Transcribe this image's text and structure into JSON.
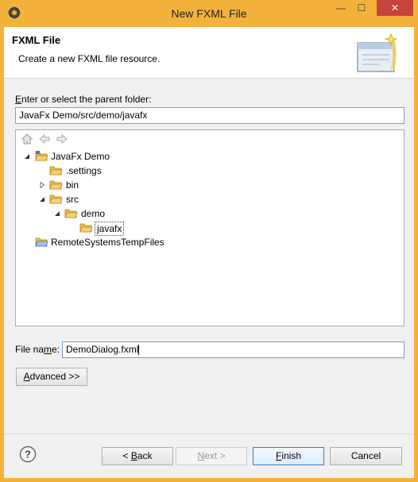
{
  "window": {
    "title": "New FXML File",
    "minimize_glyph": "—",
    "maximize_glyph": "☐",
    "close_glyph": "✕"
  },
  "banner": {
    "title": "FXML File",
    "description": "Create a new FXML file resource."
  },
  "parent_folder": {
    "label_prefix": "",
    "label_mnemonic": "E",
    "label_rest": "nter or select the parent folder:",
    "value": "JavaFx Demo/src/demo/javafx"
  },
  "tree": {
    "toolbar": [
      "home-icon",
      "back-arrow-icon",
      "forward-arrow-icon"
    ],
    "nodes": [
      {
        "label": "JavaFx Demo",
        "depth": 0,
        "expanded": true,
        "type": "project"
      },
      {
        "label": ".settings",
        "depth": 1,
        "expanded": null,
        "type": "folder"
      },
      {
        "label": "bin",
        "depth": 1,
        "expanded": false,
        "type": "folder"
      },
      {
        "label": "src",
        "depth": 1,
        "expanded": true,
        "type": "folder"
      },
      {
        "label": "demo",
        "depth": 2,
        "expanded": true,
        "type": "folder"
      },
      {
        "label": "javafx",
        "depth": 3,
        "expanded": null,
        "type": "folder",
        "selected": true
      },
      {
        "label": "RemoteSystemsTempFiles",
        "depth": 0,
        "expanded": null,
        "type": "project"
      }
    ]
  },
  "file_name": {
    "label_prefix": "File na",
    "label_mnemonic": "m",
    "label_rest": "e:",
    "value": "DemoDialog.fxml"
  },
  "buttons": {
    "advanced_mnemonic": "A",
    "advanced_rest": "dvanced >>",
    "back_prefix": "< ",
    "back_mnemonic": "B",
    "back_rest": "ack",
    "next_mnemonic": "N",
    "next_rest": "ext >",
    "finish_mnemonic": "F",
    "finish_rest": "inish",
    "cancel": "Cancel"
  },
  "colors": {
    "titlebar": "#f3b23c",
    "close_button": "#c7443a",
    "dialog_bg": "#f0f0f0",
    "folder": "#e8b84a"
  }
}
